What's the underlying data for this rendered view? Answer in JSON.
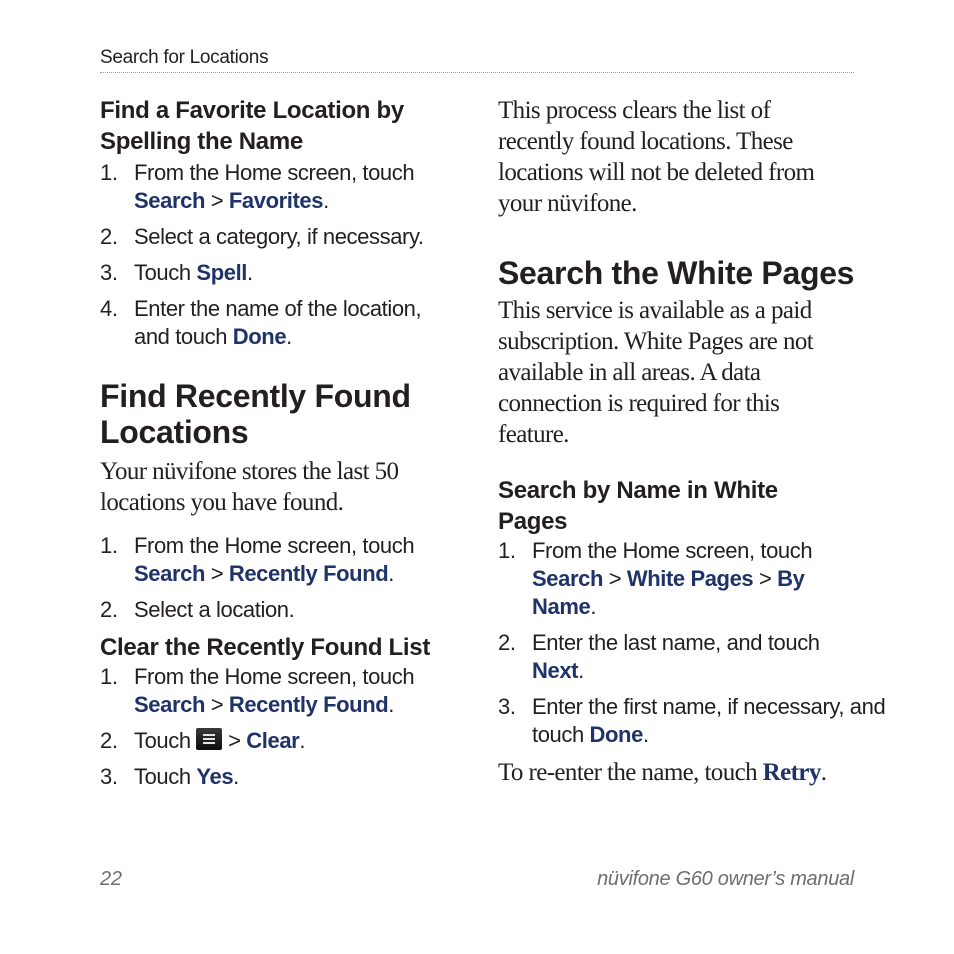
{
  "header": {
    "running_head": "Search for Locations"
  },
  "left_column": {
    "favorite": {
      "title": "Find a Favorite Location by Spelling the Name",
      "steps": [
        {
          "num": "1.",
          "text": "From the Home screen, touch ",
          "kw1": "Search",
          "sep": " > ",
          "kw2": "Favorites",
          "end": "."
        },
        {
          "num": "2.",
          "text": "Select a category, if necessary."
        },
        {
          "num": "3.",
          "text": "Touch ",
          "kw1": "Spell",
          "end": "."
        },
        {
          "num": "4.",
          "text": "Enter the name of the location, and touch ",
          "kw1": "Done",
          "end": "."
        }
      ]
    },
    "recent": {
      "title": "Find Recently Found Locations",
      "intro": "Your nüvifone stores the last 50 locations you have found.",
      "steps": [
        {
          "num": "1.",
          "text": "From the Home screen, touch ",
          "kw1": "Search",
          "sep": " > ",
          "kw2": "Recently Found",
          "end": "."
        },
        {
          "num": "2.",
          "text": "Select a location."
        }
      ]
    },
    "clear": {
      "title": "Clear the Recently Found List",
      "steps": [
        {
          "num": "1.",
          "text": "From the Home screen, touch ",
          "kw1": "Search",
          "sep": " > ",
          "kw2": "Recently Found",
          "end": "."
        },
        {
          "num": "2.",
          "text": "Touch ",
          "icon": "menu-icon",
          "sep": " > ",
          "kw1": "Clear",
          "end": "."
        },
        {
          "num": "3.",
          "text": "Touch ",
          "kw1": "Yes",
          "end": "."
        }
      ]
    }
  },
  "right_column": {
    "clear_note": "This process clears the list of recently found locations. These locations will not be deleted from your nüvifone.",
    "white_pages": {
      "title": "Search the White Pages",
      "intro": "This service is available as a paid subscription. White Pages are not available in all areas. A data connection is required for this feature."
    },
    "by_name": {
      "title": "Search by Name in White Pages",
      "steps": [
        {
          "num": "1.",
          "text": "From the Home screen, touch ",
          "kw1": "Search",
          "sep": " > ",
          "kw2": "White Pages",
          "sep2": " > ",
          "kw3": "By Name",
          "end": "."
        },
        {
          "num": "2.",
          "text": "Enter the last name, and touch ",
          "kw1": "Next",
          "end": "."
        },
        {
          "num": "3.",
          "text": "Enter the first name, if necessary, and touch ",
          "kw1": "Done",
          "end": "."
        }
      ],
      "retry_text": "To re-enter the name, touch ",
      "retry_kw": "Retry",
      "retry_end": "."
    }
  },
  "footer": {
    "page_number": "22",
    "manual_title": "nüvifone G60 owner’s manual"
  },
  "colors": {
    "keyword": "#1f3368",
    "text": "#231f20",
    "folio": "#6d6e71"
  }
}
